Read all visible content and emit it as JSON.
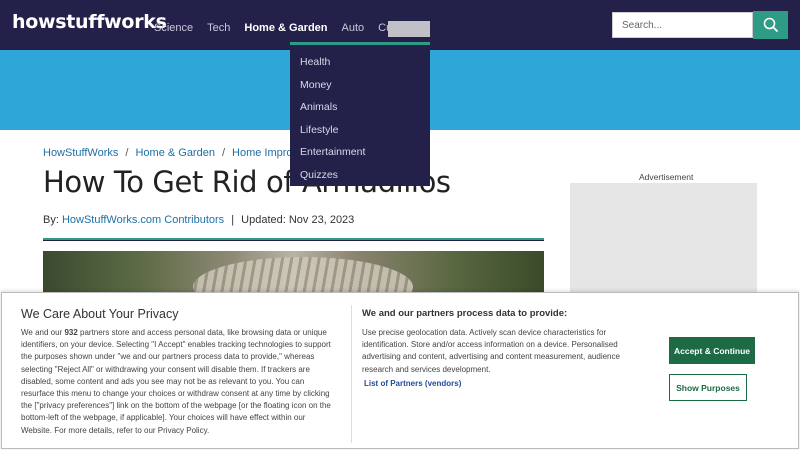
{
  "header": {
    "logo_text": "howstuffworks",
    "nav": [
      "Science",
      "Tech",
      "Home & Garden",
      "Auto",
      "Culture"
    ],
    "active_nav": "Home & Garden",
    "search_placeholder": "Search..."
  },
  "dropdown": {
    "items": [
      "Health",
      "Money",
      "Animals",
      "Lifestyle",
      "Entertainment",
      "Quizzes"
    ]
  },
  "article": {
    "breadcrumb": [
      "HowStuffWorks",
      "Home & Garden",
      "Home Improvem"
    ],
    "breadcrumb_sep": "/",
    "title": "How To Get Rid of Armadillos",
    "by_label": "By:",
    "author": "HowStuffWorks.com Contributors",
    "divider": "|",
    "updated": "Updated: Nov 23, 2023"
  },
  "sidebar": {
    "ad_label": "Advertisement"
  },
  "consent": {
    "title": "We Care About Your Privacy",
    "body_pre": "We and our ",
    "partner_count": "932",
    "body_post": " partners store and access personal data, like browsing data or unique identifiers, on your device. Selecting \"I Accept\" enables tracking technologies to support the purposes shown under \"we and our partners process data to provide,\" whereas selecting \"Reject All\" or withdrawing your consent will disable them. If trackers are disabled, some content and ads you see may not be as relevant to you. You can resurface this menu to change your choices or withdraw consent at any time by clicking the [\"privacy preferences\"] link on the bottom of the webpage [or the floating icon on the bottom-left of the webpage, if applicable]. Your choices will have effect within our Website. For more details, refer to our Privacy Policy.",
    "process_title": "We and our partners process data to provide:",
    "process_body": "Use precise geolocation data. Actively scan device characteristics for identification. Store and/or access information on a device. Personalised advertising and content, advertising and content measurement, audience research and services development.",
    "partners_link": "List of Partners (vendors)",
    "accept_label": "Accept & Continue",
    "purposes_label": "Show Purposes"
  },
  "colors": {
    "nav_bg": "#232149",
    "hero_bg": "#2ea6d7",
    "accent": "#2e9b86",
    "link": "#1e6fa6",
    "accept_bg": "#1d6b44"
  }
}
